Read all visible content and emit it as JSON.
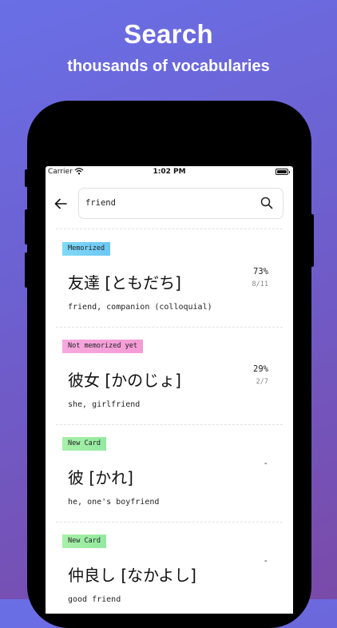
{
  "hero": {
    "title": "Search",
    "subtitle": "thousands of vocabularies"
  },
  "status_bar": {
    "carrier": "Carrier",
    "time": "1:02 PM"
  },
  "search": {
    "value": "friend",
    "placeholder": ""
  },
  "results": [
    {
      "status": "Memorized",
      "status_color": "#7fd9f7",
      "word": "友達 [ともだち]",
      "meaning": "friend, companion (colloquial)",
      "percent": "73%",
      "count": "8/11"
    },
    {
      "status": "Not memorized yet",
      "status_color": "#f7a8de",
      "word": "彼女 [かのじょ]",
      "meaning": "she, girlfriend",
      "percent": "29%",
      "count": "2/7"
    },
    {
      "status": "New Card",
      "status_color": "#a8f0a8",
      "word": "彼 [かれ]",
      "meaning": "he, one's boyfriend",
      "percent": "-",
      "count": ""
    },
    {
      "status": "New Card",
      "status_color": "#a8f0a8",
      "word": "仲良し [なかよし]",
      "meaning": "good friend",
      "percent": "-",
      "count": ""
    }
  ],
  "icons": {
    "back": "arrow-left-icon",
    "search": "magnifier-icon",
    "wifi": "wifi-icon",
    "battery": "battery-icon"
  }
}
